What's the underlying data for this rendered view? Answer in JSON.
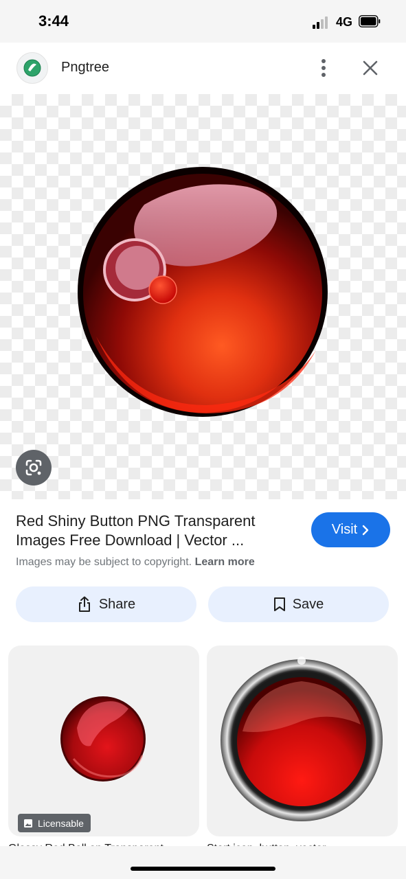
{
  "status_bar": {
    "time": "3:44",
    "network": "4G"
  },
  "header": {
    "site_name": "Pngtree",
    "favicon": "pngtree-logo-icon",
    "menu_icon": "more-vert-icon",
    "close_icon": "close-icon"
  },
  "viewer": {
    "lens_icon": "google-lens-icon"
  },
  "result": {
    "title": "Red Shiny Button PNG Transparent Images Free Download | Vector ...",
    "visit_label": "Visit",
    "copyright_text": "Images may be subject to copyright.",
    "learn_more": "Learn more"
  },
  "actions": {
    "share_label": "Share",
    "save_label": "Save"
  },
  "related": [
    {
      "badge": "Licensable",
      "caption": "Glossy Red Ball on Transparent"
    },
    {
      "caption": "Start icon, button, vector"
    }
  ],
  "colors": {
    "accent": "#1a73e8",
    "pill": "#e8f0fe"
  }
}
